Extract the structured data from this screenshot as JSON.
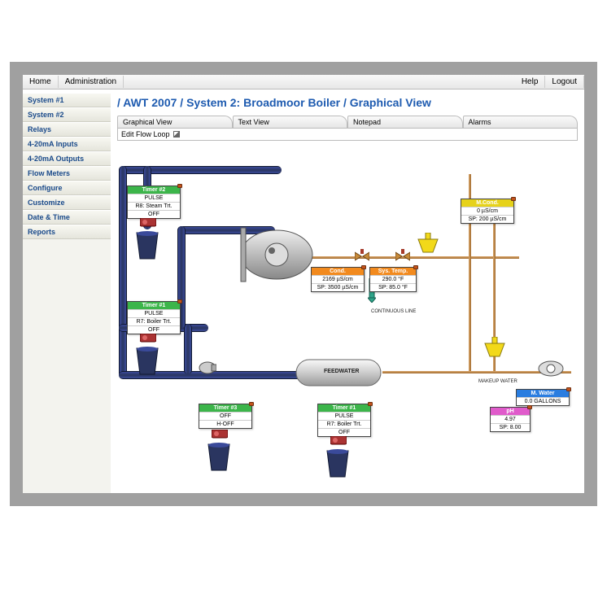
{
  "menubar": {
    "home": "Home",
    "admin": "Administration",
    "help": "Help",
    "logout": "Logout"
  },
  "sidebar": {
    "items": [
      {
        "label": "System #1"
      },
      {
        "label": "System #2"
      },
      {
        "label": "Relays"
      },
      {
        "label": "4-20mA Inputs"
      },
      {
        "label": "4-20mA Outputs"
      },
      {
        "label": "Flow Meters"
      },
      {
        "label": "Configure"
      },
      {
        "label": "Customize"
      },
      {
        "label": "Date & Time"
      },
      {
        "label": "Reports"
      }
    ]
  },
  "breadcrumb": "/ AWT 2007 / System 2: Broadmoor Boiler  / Graphical View",
  "tabs": {
    "t1": "Graphical View",
    "t2": "Text View",
    "t3": "Notepad",
    "t4": "Alarms"
  },
  "toolbar": {
    "edit": "Edit Flow Loop"
  },
  "labels": {
    "feedwater": "FEEDWATER",
    "contline": "CONTINUOUS LINE",
    "makeup": "MAKEUP WATER"
  },
  "dev": {
    "timer2": {
      "title": "Timer #2",
      "l1": "PULSE",
      "l2": "R8: Steam Trt.",
      "l3": "OFF"
    },
    "timer1": {
      "title": "Timer #1",
      "l1": "PULSE",
      "l2": "R7: Boiler Trt.",
      "l3": "OFF"
    },
    "timer3": {
      "title": "Timer #3",
      "l1": "OFF",
      "l2": "H-OFF"
    },
    "timer1b": {
      "title": "Timer #1",
      "l1": "PULSE",
      "l2": "R7: Boiler Trt.",
      "l3": "OFF"
    },
    "cond": {
      "title": "Cond.",
      "l1": "2169 µS/cm",
      "l2": "SP: 3500 µS/cm"
    },
    "systemp": {
      "title": "Sys. Temp.",
      "l1": "290.0 °F",
      "l2": "SP: 85.0 °F"
    },
    "mcond": {
      "title": "M.Cond.",
      "l1": "0 µS/cm",
      "l2": "SP: 200 µS/cm"
    },
    "mwater": {
      "title": "M. Water",
      "l1": "0.0 GALLONS"
    },
    "ph": {
      "title": "pH",
      "l1": "4.97",
      "l2": "SP: 8.00"
    }
  }
}
